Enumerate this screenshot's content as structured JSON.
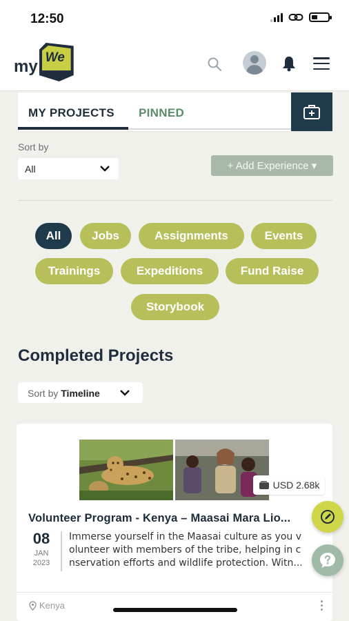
{
  "status_bar": {
    "time": "12:50"
  },
  "header": {
    "logo_my": "my",
    "logo_we": "We"
  },
  "tabs": {
    "my_projects": "MY PROJECTS",
    "pinned": "PINNED"
  },
  "filters": {
    "sort_by_label": "Sort by",
    "sort_value": "All",
    "add_experience": "+ Add Experience ▾"
  },
  "chips": [
    "All",
    "Jobs",
    "Assignments",
    "Events",
    "Trainings",
    "Expeditions",
    "Fund Raise",
    "Storybook"
  ],
  "section": {
    "title": "Completed Projects",
    "sort_prefix": "Sort by",
    "sort_value": "Timeline"
  },
  "project": {
    "title": "Volunteer Program - Kenya – Maasai Mara Lio...",
    "price": "USD 2.68k",
    "day": "08",
    "month": "JAN",
    "year": "2023",
    "desc_lines": [
      "Immerse yourself in the Maasai culture as you v",
      "olunteer with members of the tribe, helping in c",
      "nservation efforts and wildlife protection. Witn..."
    ],
    "location": "Kenya"
  },
  "colors": {
    "navy": "#1f3a4a",
    "chip_olive": "#b7bf5a",
    "pinned_green": "#5c8c6a",
    "fab_yellow": "#cfd648",
    "fab_help": "#9fbba8"
  }
}
